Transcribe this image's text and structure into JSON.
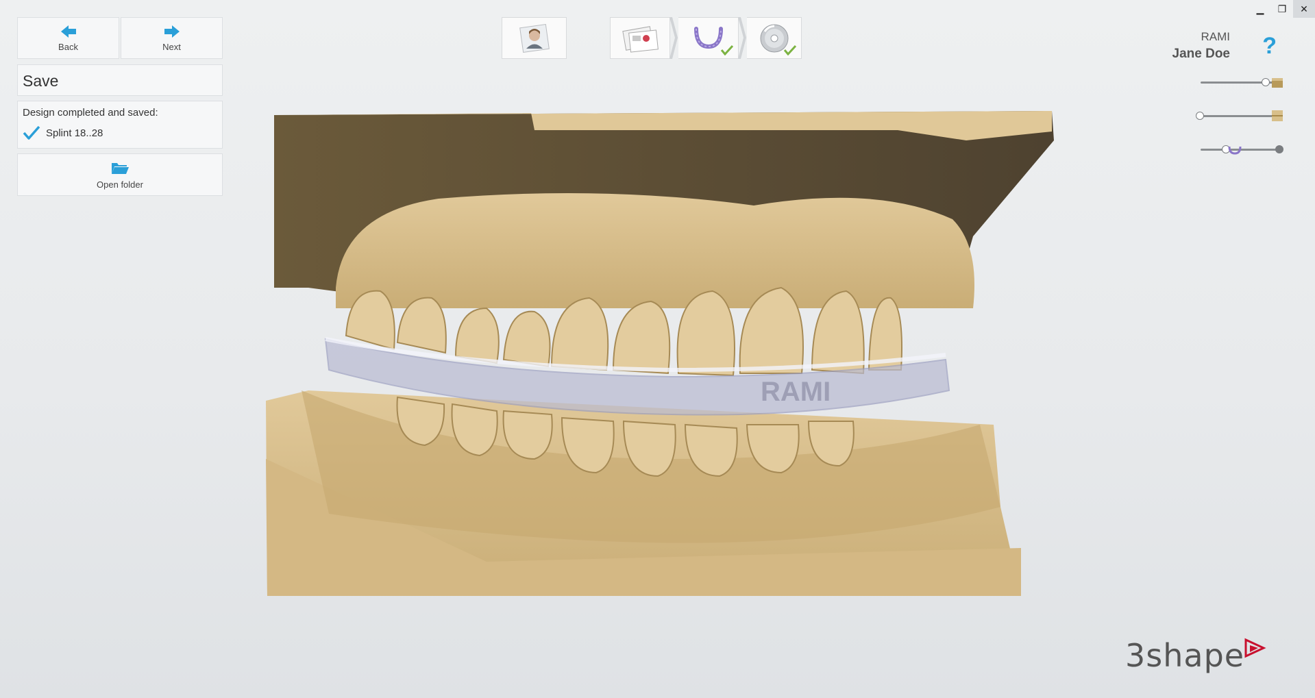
{
  "window": {
    "minimize": "▁",
    "restore": "❐",
    "close": "✕"
  },
  "nav": {
    "back_label": "Back",
    "next_label": "Next"
  },
  "panel": {
    "title": "Save",
    "status_heading": "Design completed and saved:",
    "saved_item": "Splint 18..28",
    "open_folder_label": "Open folder"
  },
  "user": {
    "org": "RAMI",
    "name": "Jane Doe"
  },
  "help_label": "?",
  "brand": {
    "logo_text": "3shape",
    "accent": "#c8102e"
  },
  "splint_engraving": "RAMI",
  "sliders": [
    {
      "name": "upper-model-opacity",
      "value": 1.0
    },
    {
      "name": "lower-model-opacity",
      "value": 0.0
    },
    {
      "name": "splint-opacity",
      "value": 0.4
    }
  ],
  "colors": {
    "accent": "#2a9fd8",
    "check": "#7cb342",
    "model": "#d8bf8a"
  }
}
